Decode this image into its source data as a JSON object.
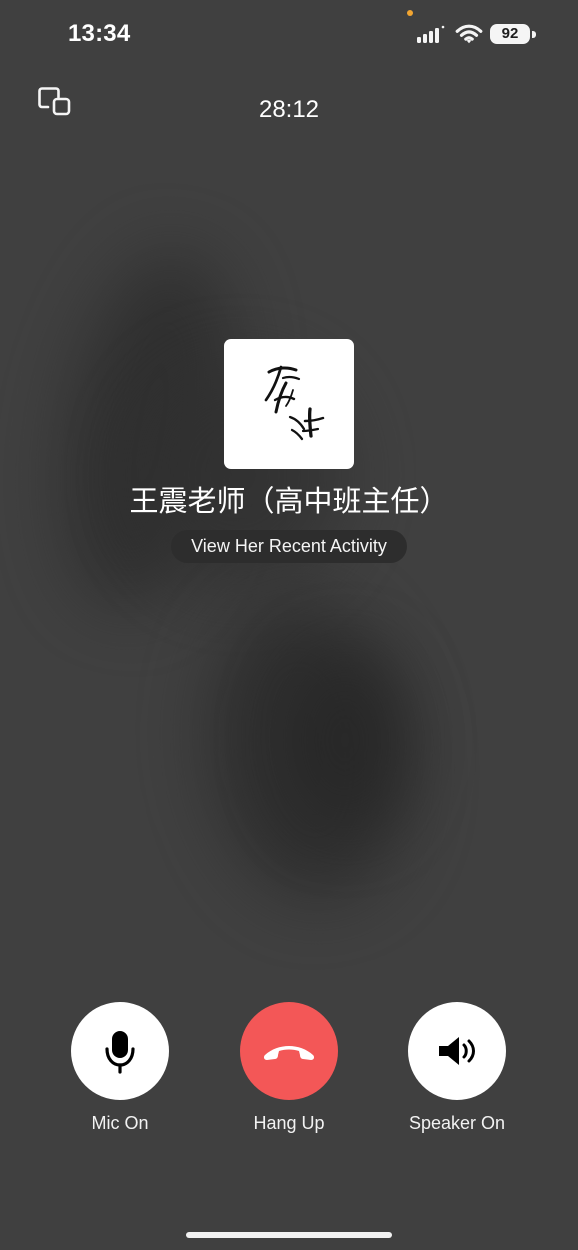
{
  "status_bar": {
    "time": "13:34",
    "battery_level": "92",
    "icons": [
      "signal-icon",
      "wifi-icon",
      "battery-icon"
    ],
    "privacy_indicator_color": "#f2a531"
  },
  "call": {
    "minimize_icon": "minimize-call-icon",
    "timer": "28:12",
    "avatar_icon": "calligraphy-avatar",
    "avatar_signature_text": "高斗",
    "contact_name": "王震老师（高中班主任）",
    "recent_activity_label": "View Her Recent Activity"
  },
  "controls": {
    "mic": {
      "label": "Mic On",
      "icon": "microphone-icon"
    },
    "hangup": {
      "label": "Hang Up",
      "icon": "phone-hangup-icon"
    },
    "speaker": {
      "label": "Speaker On",
      "icon": "speaker-icon"
    }
  },
  "colors": {
    "background": "#404040",
    "hangup_red": "#f35757",
    "button_white": "#ffffff",
    "pill_dark": "#2d2d2d"
  }
}
